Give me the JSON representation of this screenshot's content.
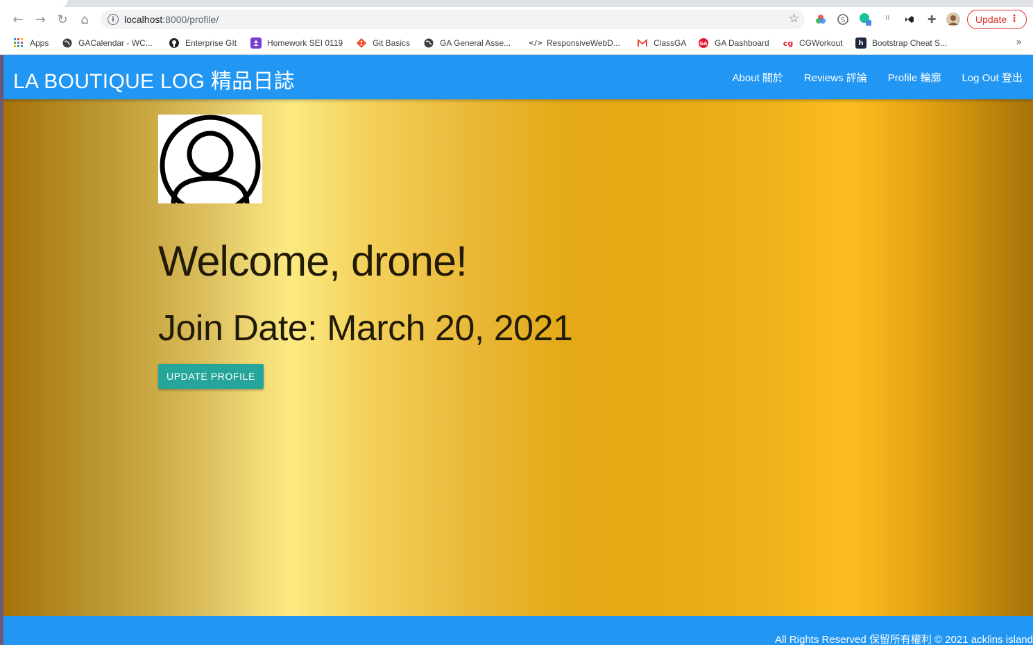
{
  "browser": {
    "url_host": "localhost",
    "url_path": ":8000/profile/",
    "update_label": "Update",
    "bookmarks": [
      {
        "label": "Apps",
        "icon": "apps-grid-icon"
      },
      {
        "label": "GACalendar - WC...",
        "icon": "globe-icon"
      },
      {
        "label": "Enterprise GIt",
        "icon": "github-icon"
      },
      {
        "label": "Homework SEI 0119",
        "icon": "person-card-icon"
      },
      {
        "label": "Git Basics",
        "icon": "git-icon"
      },
      {
        "label": "GA General Asse...",
        "icon": "globe-icon"
      },
      {
        "label": "ResponsiveWebD...",
        "icon": "code-icon"
      },
      {
        "label": "ClassGA",
        "icon": "gmail-icon"
      },
      {
        "label": "GA Dashboard",
        "icon": "ga-logo-icon"
      },
      {
        "label": "CGWorkout",
        "icon": "cg-logo-icon"
      },
      {
        "label": "Bootstrap Cheat S...",
        "icon": "h-logo-icon"
      }
    ]
  },
  "app": {
    "brand": "LA BOUTIQUE LOG 精品日誌",
    "nav": {
      "about": "About 關於",
      "reviews": "Reviews 評論",
      "profile": "Profile 輪廓",
      "logout": "Log Out 登出"
    }
  },
  "profile": {
    "welcome": "Welcome, drone!",
    "join_date": "Join Date: March 20, 2021",
    "update_button": "UPDATE PROFILE"
  },
  "footer": {
    "copyright": "All Rights Reserved 保留所有權利 © 2021 acklins island"
  }
}
